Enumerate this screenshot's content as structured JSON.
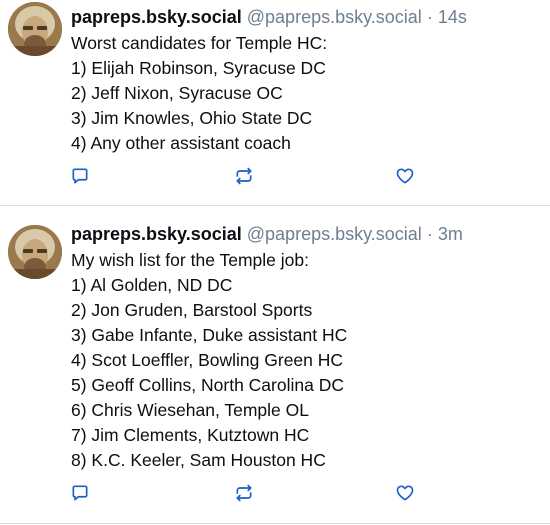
{
  "colors": {
    "text": "#0b0f14",
    "muted": "#6f7f90",
    "accent": "#1d5fc9",
    "divider": "#d9dee4"
  },
  "posts": [
    {
      "display_name": "papreps.bsky.social",
      "handle": "@papreps.bsky.social",
      "separator": "·",
      "time": "14s",
      "lines": [
        "Worst candidates for Temple HC:",
        "1) Elijah Robinson, Syracuse DC",
        "2) Jeff Nixon, Syracuse OC",
        "3) Jim Knowles, Ohio State DC",
        "4) Any other assistant coach"
      ],
      "icons": {
        "reply": "reply-icon",
        "repost": "repost-icon",
        "like": "heart-icon"
      }
    },
    {
      "display_name": "papreps.bsky.social",
      "handle": "@papreps.bsky.social",
      "separator": "·",
      "time": "3m",
      "lines": [
        "My wish list for the Temple job:",
        "1) Al Golden, ND DC",
        "2) Jon Gruden, Barstool Sports",
        "3) Gabe Infante, Duke assistant HC",
        "4) Scot Loeffler, Bowling Green HC",
        "5) Geoff Collins, North Carolina DC",
        "6) Chris Wiesehan, Temple OL",
        "7) Jim Clements, Kutztown HC",
        "8) K.C. Keeler, Sam Houston HC"
      ],
      "icons": {
        "reply": "reply-icon",
        "repost": "repost-icon",
        "like": "heart-icon"
      }
    }
  ]
}
